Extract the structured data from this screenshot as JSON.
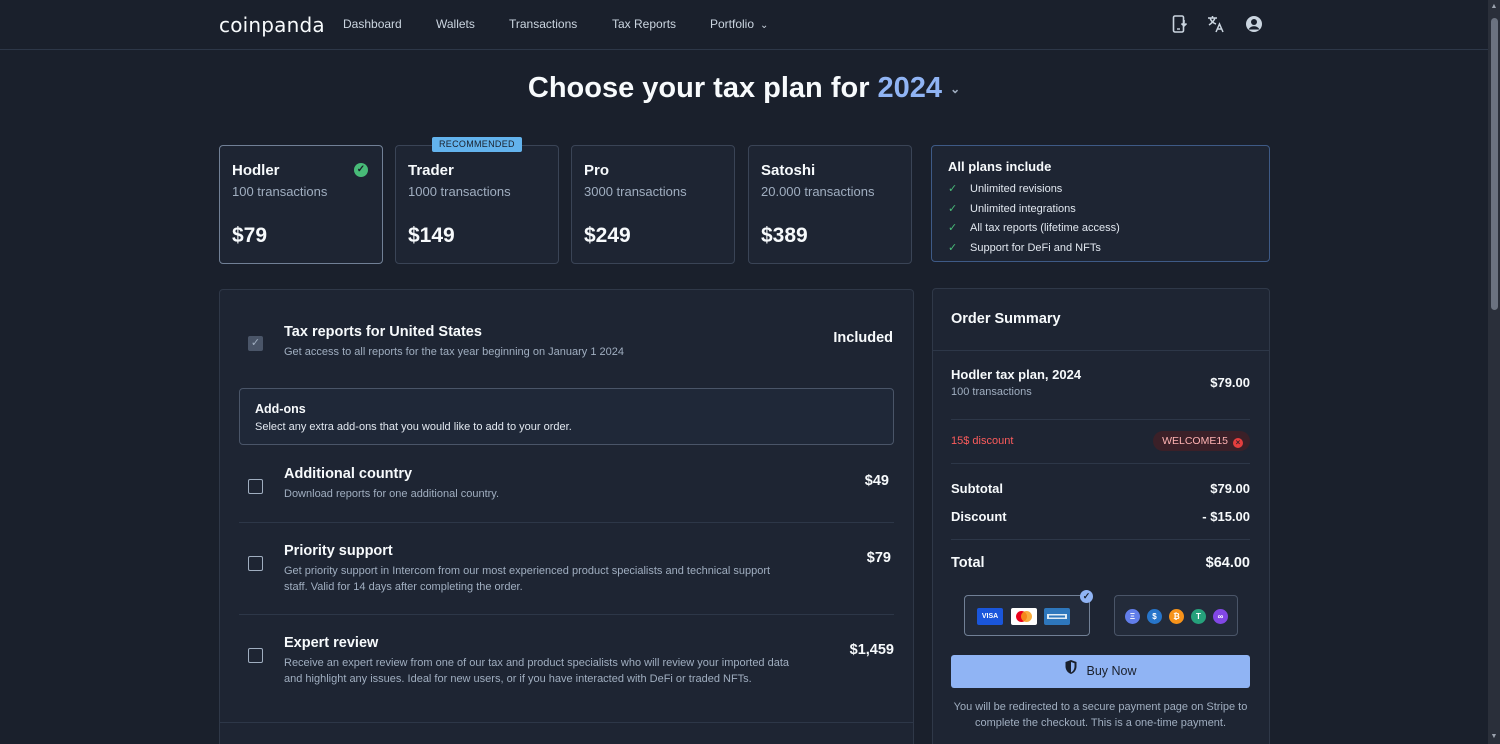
{
  "nav": {
    "logo": "coinpanda",
    "links": [
      "Dashboard",
      "Wallets",
      "Transactions",
      "Tax Reports",
      "Portfolio"
    ]
  },
  "title": {
    "prefix": "Choose your tax plan for",
    "year": "2024"
  },
  "plans": [
    {
      "name": "Hodler",
      "transactions": "100 transactions",
      "price": "$79",
      "selected": true
    },
    {
      "name": "Trader",
      "transactions": "1000 transactions",
      "price": "$149",
      "badge": "RECOMMENDED"
    },
    {
      "name": "Pro",
      "transactions": "3000 transactions",
      "price": "$249"
    },
    {
      "name": "Satoshi",
      "transactions": "20.000 transactions",
      "price": "$389"
    }
  ],
  "includes": {
    "title": "All plans include",
    "items": [
      "Unlimited revisions",
      "Unlimited integrations",
      "All tax reports (lifetime access)",
      "Support for DeFi and NFTs"
    ]
  },
  "main": {
    "tax_report": {
      "title": "Tax reports for United States",
      "desc": "Get access to all reports for the tax year beginning on January 1 2024",
      "status": "Included"
    },
    "addons_header": {
      "title": "Add-ons",
      "desc": "Select any extra add-ons that you would like to add to your order."
    },
    "addons": [
      {
        "title": "Additional country",
        "desc": "Download reports for one additional country.",
        "price": "$49"
      },
      {
        "title": "Priority support",
        "desc": "Get priority support in Intercom from our most experienced product specialists and technical support staff. Valid for 14 days after completing the order.",
        "price": "$79"
      },
      {
        "title": "Expert review",
        "desc": "Receive an expert review from one of our tax and product specialists who will review your imported data and highlight any issues. Ideal for new users, or if you have interacted with DeFi or traded NFTs.",
        "price": "$1,459"
      }
    ]
  },
  "order": {
    "title": "Order Summary",
    "plan_line": "Hodler tax plan, 2024",
    "plan_sub": "100 transactions",
    "plan_price": "$79.00",
    "discount_label": "15$ discount",
    "coupon": "WELCOME15",
    "subtotal_label": "Subtotal",
    "subtotal": "$79.00",
    "discount_row_label": "Discount",
    "discount_value": "- $15.00",
    "total_label": "Total",
    "total": "$64.00",
    "card_icons": [
      "VISA",
      "mastercard-icon",
      "amex-icon"
    ],
    "crypto_icons": [
      "ethereum-icon",
      "usdc-icon",
      "bitcoin-icon",
      "tether-icon",
      "polygon-icon"
    ],
    "buy_label": "Buy Now",
    "redirect_text": "You will be redirected to a secure payment page on Stripe to complete the checkout. This is a one-time payment."
  },
  "colors": {
    "background": "#1a202c",
    "accent": "#90b4f4",
    "success": "#48bb78",
    "danger": "#fc5c5c"
  }
}
